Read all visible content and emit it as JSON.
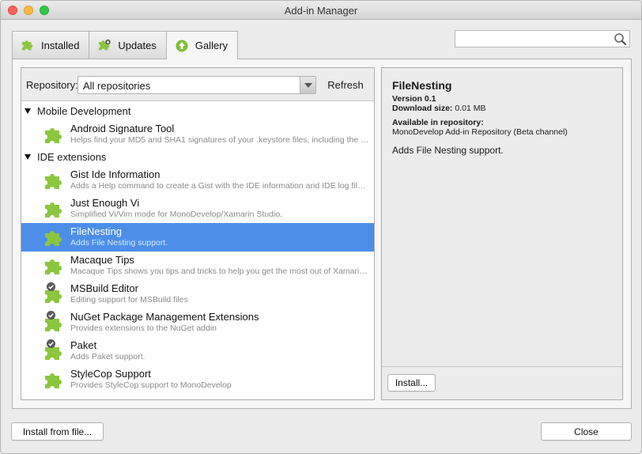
{
  "window": {
    "title": "Add-in Manager"
  },
  "tabs": [
    {
      "label": "Installed",
      "icon": "puzzle-icon"
    },
    {
      "label": "Updates",
      "icon": "puzzle-update-icon"
    },
    {
      "label": "Gallery",
      "icon": "gallery-up-arrow-icon",
      "active": true
    }
  ],
  "search": {
    "value": "",
    "placeholder": ""
  },
  "repository": {
    "label": "Repository:",
    "selected": "All repositories",
    "refresh_label": "Refresh"
  },
  "categories": [
    {
      "name": "Mobile Development",
      "items": [
        {
          "name": "Android Signature Tool",
          "desc": "Helps find your MD5 and SHA1 signatures of your .keystore files, including the def...",
          "installed": false
        }
      ]
    },
    {
      "name": "IDE extensions",
      "items": [
        {
          "name": "Gist Ide Information",
          "desc": "Adds a Help command to create a Gist with the IDE information and IDE log files. ...",
          "installed": false
        },
        {
          "name": "Just Enough Vi",
          "desc": "Simplified Vi/Vim mode for MonoDevelop/Xamarin Studio.",
          "installed": false
        },
        {
          "name": "FileNesting",
          "desc": "Adds File Nesting support.",
          "installed": false,
          "selected": true
        },
        {
          "name": "Macaque Tips",
          "desc": "Macaque Tips shows you tips and tricks to help you get the most out of Xamarin S...",
          "installed": false
        },
        {
          "name": "MSBuild Editor",
          "desc": "Editing support for MSBuild files",
          "installed": true
        },
        {
          "name": "NuGet Package Management Extensions",
          "desc": "Provides extensions to the NuGet addin",
          "installed": true
        },
        {
          "name": "Paket",
          "desc": "Adds Paket support.",
          "installed": true
        },
        {
          "name": "StyleCop Support",
          "desc": "Provides StyleCop support to MonoDevelop",
          "installed": false
        }
      ]
    }
  ],
  "detail": {
    "name": "FileNesting",
    "version_label": "Version",
    "version": "0.1",
    "size_label": "Download size:",
    "size": "0.01 MB",
    "repo_label": "Available in repository:",
    "repo": "MonoDevelop Add-in Repository (Beta channel)",
    "summary": "Adds File Nesting support.",
    "install_label": "Install..."
  },
  "footer": {
    "install_file_label": "Install from file...",
    "close_label": "Close"
  },
  "colors": {
    "selection": "#4d8ee8",
    "puzzle": "#8cc63f"
  }
}
